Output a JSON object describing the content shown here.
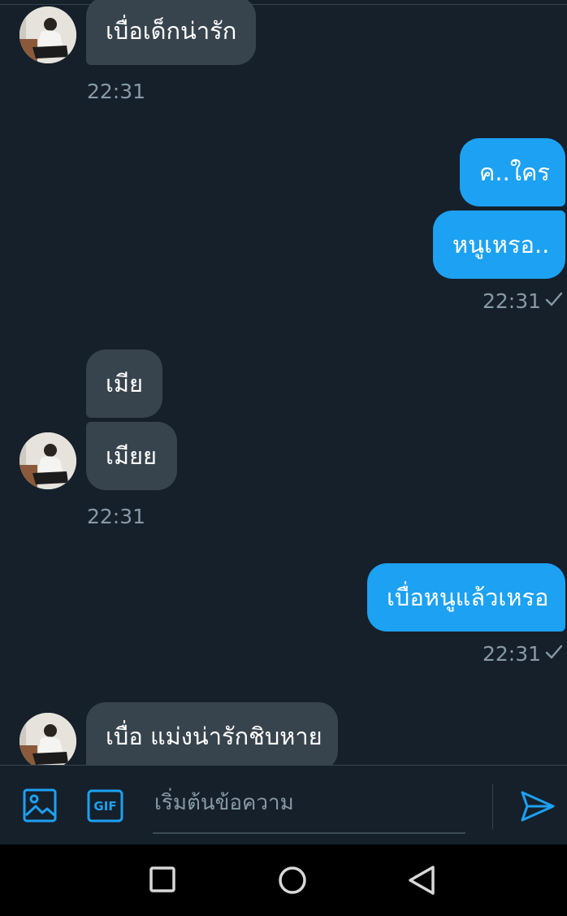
{
  "theme": {
    "background": "#15202b",
    "incoming_bubble": "#38444d",
    "outgoing_bubble": "#1da1f2",
    "timestamp_color": "#8899a6",
    "accent": "#1da1f2"
  },
  "messages": [
    {
      "direction": "incoming",
      "text": "เบื่อเด็กน่ารัก"
    },
    {
      "direction": "incoming_time",
      "time": "22:31"
    },
    {
      "direction": "outgoing",
      "text": "ค..ใคร"
    },
    {
      "direction": "outgoing",
      "text": "หนูเหรอ.."
    },
    {
      "direction": "outgoing_time",
      "time": "22:31"
    },
    {
      "direction": "incoming",
      "text": "เมีย"
    },
    {
      "direction": "incoming",
      "text": "เมียย"
    },
    {
      "direction": "incoming_time",
      "time": "22:31"
    },
    {
      "direction": "outgoing",
      "text": "เบื่อหนูแล้วเหรอ"
    },
    {
      "direction": "outgoing_time",
      "time": "22:31"
    },
    {
      "direction": "incoming",
      "text": "เบื่อ แม่งน่ารักชิบหาย"
    }
  ],
  "composer": {
    "placeholder": "เริ่มต้นข้อความ",
    "value": "",
    "image_icon": "image-icon",
    "gif_label": "GIF",
    "send_icon": "send-icon"
  },
  "navbar": {
    "recents_icon": "square-icon",
    "home_icon": "circle-icon",
    "back_icon": "triangle-back-icon"
  }
}
